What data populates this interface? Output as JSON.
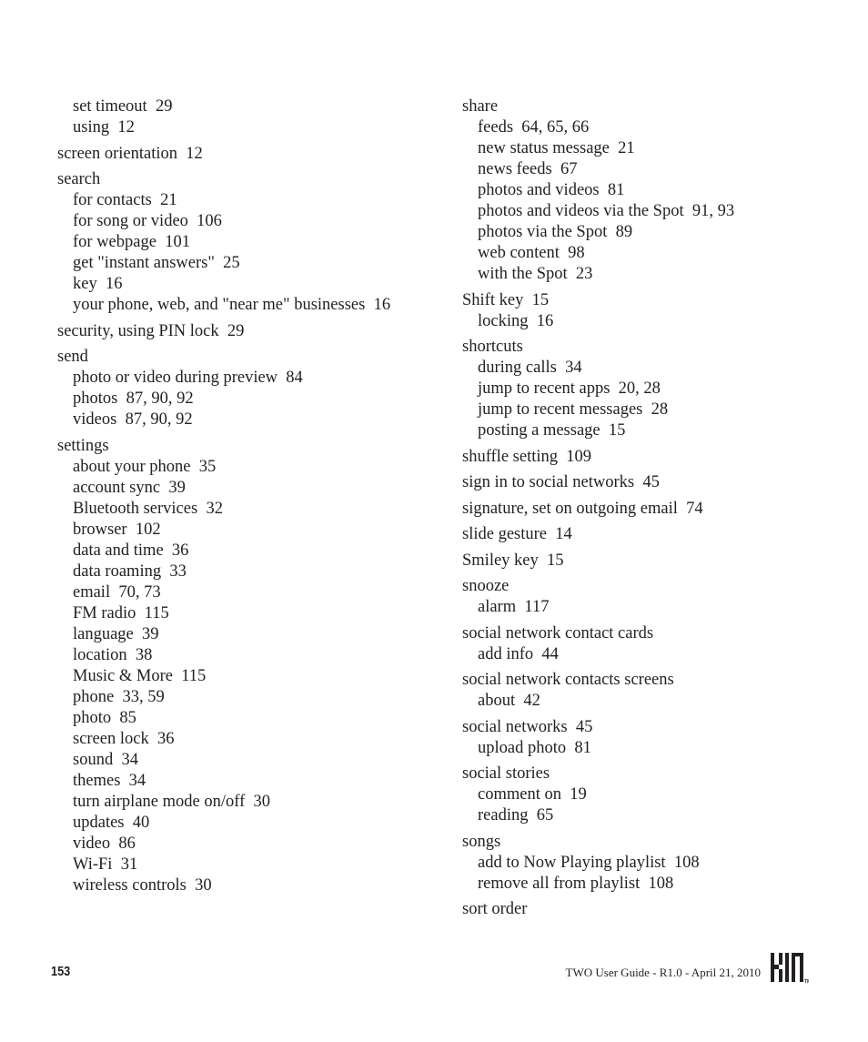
{
  "left_column": [
    {
      "term": null,
      "subs": [
        {
          "text": "set timeout",
          "pages": "29"
        },
        {
          "text": "using",
          "pages": "12"
        }
      ]
    },
    {
      "term": "screen orientation",
      "pages": "12",
      "subs": []
    },
    {
      "term": "search",
      "pages": null,
      "subs": [
        {
          "text": "for contacts",
          "pages": "21"
        },
        {
          "text": "for song or video",
          "pages": "106"
        },
        {
          "text": "for webpage",
          "pages": "101"
        },
        {
          "text": "get \"instant answers\"",
          "pages": "25"
        },
        {
          "text": "key",
          "pages": "16"
        },
        {
          "text": "your phone, web, and \"near me\" businesses",
          "pages": "16",
          "wrap": true
        }
      ]
    },
    {
      "term": "security, using PIN lock",
      "pages": "29",
      "subs": []
    },
    {
      "term": "send",
      "pages": null,
      "subs": [
        {
          "text": "photo or video during preview",
          "pages": "84"
        },
        {
          "text": "photos",
          "pages": "87, 90, 92"
        },
        {
          "text": "videos",
          "pages": "87, 90, 92"
        }
      ]
    },
    {
      "term": "settings",
      "pages": null,
      "subs": [
        {
          "text": "about your phone",
          "pages": "35"
        },
        {
          "text": "account sync",
          "pages": "39"
        },
        {
          "text": "Bluetooth services",
          "pages": "32"
        },
        {
          "text": "browser",
          "pages": "102"
        },
        {
          "text": "data and time",
          "pages": "36"
        },
        {
          "text": "data roaming",
          "pages": "33"
        },
        {
          "text": "email",
          "pages": "70, 73"
        },
        {
          "text": "FM radio",
          "pages": "115"
        },
        {
          "text": "language",
          "pages": "39"
        },
        {
          "text": "location",
          "pages": "38"
        },
        {
          "text": "Music & More",
          "pages": "115"
        },
        {
          "text": "phone",
          "pages": "33, 59"
        },
        {
          "text": "photo",
          "pages": "85"
        },
        {
          "text": "screen lock",
          "pages": "36"
        },
        {
          "text": "sound",
          "pages": "34"
        },
        {
          "text": "themes",
          "pages": "34"
        },
        {
          "text": "turn airplane mode on/off",
          "pages": "30"
        },
        {
          "text": "updates",
          "pages": "40"
        },
        {
          "text": "video",
          "pages": "86"
        },
        {
          "text": "Wi-Fi",
          "pages": "31"
        },
        {
          "text": "wireless controls",
          "pages": "30"
        }
      ]
    }
  ],
  "right_column": [
    {
      "term": "share",
      "pages": null,
      "subs": [
        {
          "text": "feeds",
          "pages": "64, 65, 66"
        },
        {
          "text": "new status message",
          "pages": "21"
        },
        {
          "text": "news feeds",
          "pages": "67"
        },
        {
          "text": "photos and videos",
          "pages": "81"
        },
        {
          "text": "photos and videos via the Spot",
          "pages": "91, 93"
        },
        {
          "text": "photos via the Spot",
          "pages": "89"
        },
        {
          "text": "web content",
          "pages": "98"
        },
        {
          "text": "with the Spot",
          "pages": "23"
        }
      ]
    },
    {
      "term": "Shift key",
      "pages": "15",
      "subs": [
        {
          "text": "locking",
          "pages": "16"
        }
      ]
    },
    {
      "term": "shortcuts",
      "pages": null,
      "subs": [
        {
          "text": "during calls",
          "pages": "34"
        },
        {
          "text": "jump to recent apps",
          "pages": "20, 28"
        },
        {
          "text": "jump to recent messages",
          "pages": "28"
        },
        {
          "text": "posting a message",
          "pages": "15"
        }
      ]
    },
    {
      "term": "shuffle setting",
      "pages": "109",
      "subs": []
    },
    {
      "term": "sign in to social networks",
      "pages": "45",
      "subs": []
    },
    {
      "term": "signature, set on outgoing email",
      "pages": "74",
      "subs": []
    },
    {
      "term": "slide gesture",
      "pages": "14",
      "subs": []
    },
    {
      "term": "Smiley key",
      "pages": "15",
      "subs": []
    },
    {
      "term": "snooze",
      "pages": null,
      "subs": [
        {
          "text": "alarm",
          "pages": "117"
        }
      ]
    },
    {
      "term": "social network contact cards",
      "pages": null,
      "subs": [
        {
          "text": "add info",
          "pages": "44"
        }
      ]
    },
    {
      "term": "social network contacts screens",
      "pages": null,
      "subs": [
        {
          "text": "about",
          "pages": "42"
        }
      ]
    },
    {
      "term": "social networks",
      "pages": "45",
      "subs": [
        {
          "text": "upload photo",
          "pages": "81"
        }
      ]
    },
    {
      "term": "social stories",
      "pages": null,
      "subs": [
        {
          "text": "comment on",
          "pages": "19"
        },
        {
          "text": "reading",
          "pages": "65"
        }
      ]
    },
    {
      "term": "songs",
      "pages": null,
      "subs": [
        {
          "text": "add to Now Playing playlist",
          "pages": "108"
        },
        {
          "text": "remove all from playlist",
          "pages": "108"
        }
      ]
    },
    {
      "term": "sort order",
      "pages": null,
      "subs": []
    }
  ],
  "footer": {
    "page_number": "153",
    "doc_title": "TWO User Guide - R1.0 - April 21, 2010",
    "logo": "kin-logo-icon",
    "logo_tm": "TM"
  }
}
